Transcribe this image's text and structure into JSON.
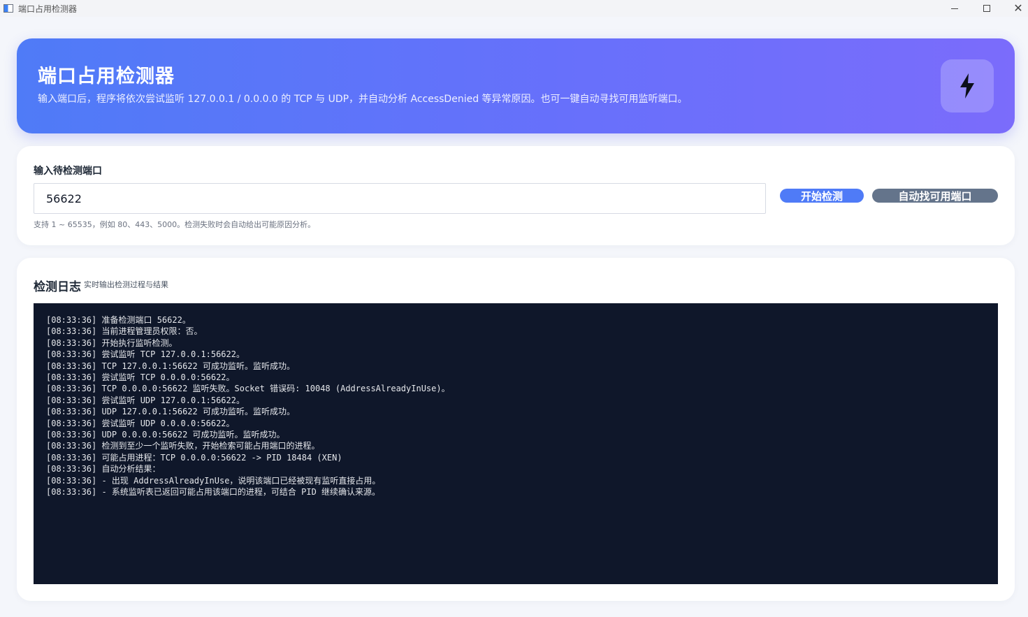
{
  "window": {
    "title": "端口占用检测器"
  },
  "hero": {
    "title": "端口占用检测器",
    "description": "输入端口后，程序将依次尝试监听 127.0.0.1 / 0.0.0.0 的 TCP 与 UDP，并自动分析 AccessDenied 等异常原因。也可一键自动寻找可用监听端口。",
    "badge_icon": "lightning-icon"
  },
  "input_card": {
    "label": "输入待检测端口",
    "port_value": "56622",
    "start_button": "开始检测",
    "auto_button": "自动找可用端口",
    "hint": "支持 1 ~ 65535，例如 80、443、5000。检测失败时会自动给出可能原因分析。"
  },
  "log_card": {
    "title": "检测日志",
    "subtitle": "实时输出检测过程与结果",
    "lines": [
      "[08:33:36] 准备检测端口 56622。",
      "[08:33:36] 当前进程管理员权限：否。",
      "[08:33:36] 开始执行监听检测。",
      "[08:33:36] 尝试监听 TCP 127.0.0.1:56622。",
      "[08:33:36] TCP 127.0.0.1:56622 可成功监听。监听成功。",
      "[08:33:36] 尝试监听 TCP 0.0.0.0:56622。",
      "[08:33:36] TCP 0.0.0.0:56622 监听失败。Socket 错误码: 10048 (AddressAlreadyInUse)。",
      "[08:33:36] 尝试监听 UDP 127.0.0.1:56622。",
      "[08:33:36] UDP 127.0.0.1:56622 可成功监听。监听成功。",
      "[08:33:36] 尝试监听 UDP 0.0.0.0:56622。",
      "[08:33:36] UDP 0.0.0.0:56622 可成功监听。监听成功。",
      "[08:33:36] 检测到至少一个监听失败，开始检索可能占用端口的进程。",
      "[08:33:36] 可能占用进程：TCP 0.0.0.0:56622 -> PID 18484 (XEN)",
      "[08:33:36] 自动分析结果：",
      "[08:33:36] - 出现 AddressAlreadyInUse，说明该端口已经被现有监听直接占用。",
      "[08:33:36] - 系统监听表已返回可能占用该端口的进程，可结合 PID 继续确认来源。"
    ]
  },
  "colors": {
    "hero_gradient_start": "#4f7bf7",
    "hero_gradient_end": "#7b6cfb",
    "start_button": "#4f7bf7",
    "auto_button": "#64748b",
    "console_bg": "#0f172a"
  }
}
